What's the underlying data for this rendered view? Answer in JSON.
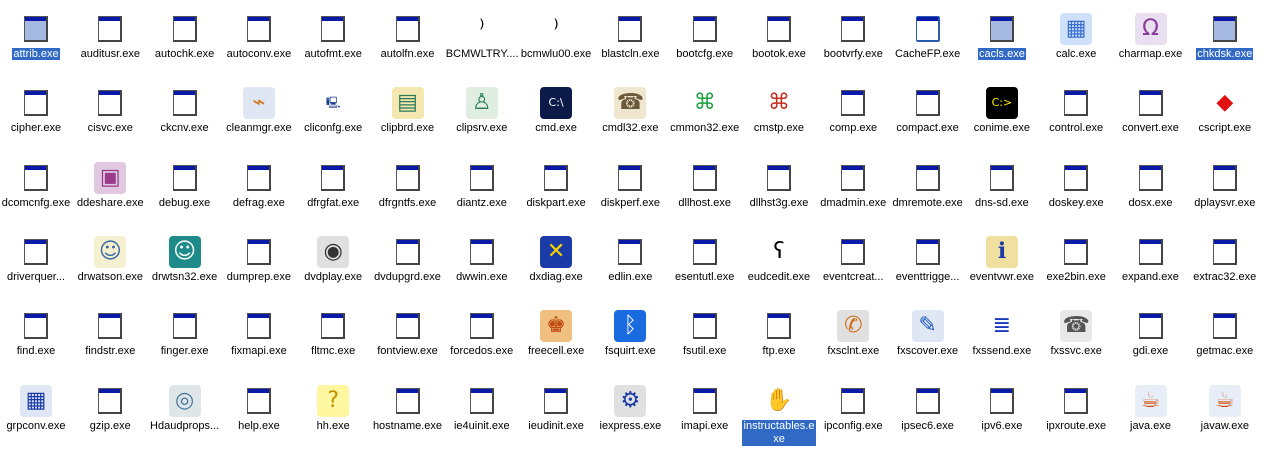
{
  "window_title": "",
  "accent_color": "#316ac5",
  "items": [
    {
      "name": "attrib.exe",
      "icon": "window",
      "selected": true
    },
    {
      "name": "auditusr.exe",
      "icon": "window"
    },
    {
      "name": "autochk.exe",
      "icon": "window"
    },
    {
      "name": "autoconv.exe",
      "icon": "window"
    },
    {
      "name": "autofmt.exe",
      "icon": "window"
    },
    {
      "name": "autolfn.exe",
      "icon": "window"
    },
    {
      "name": "BCMWLTRY....",
      "icon": "antenna"
    },
    {
      "name": "bcmwlu00.exe",
      "icon": "antenna"
    },
    {
      "name": "blastcln.exe",
      "icon": "window"
    },
    {
      "name": "bootcfg.exe",
      "icon": "window"
    },
    {
      "name": "bootok.exe",
      "icon": "window"
    },
    {
      "name": "bootvrfy.exe",
      "icon": "window"
    },
    {
      "name": "CacheFP.exe",
      "icon": "window-plain"
    },
    {
      "name": "cacls.exe",
      "icon": "window",
      "selected": true
    },
    {
      "name": "calc.exe",
      "icon": "calculator"
    },
    {
      "name": "charmap.exe",
      "icon": "charmap"
    },
    {
      "name": "chkdsk.exe",
      "icon": "window",
      "selected": true
    },
    {
      "name": "cipher.exe",
      "icon": "window"
    },
    {
      "name": "cisvc.exe",
      "icon": "window"
    },
    {
      "name": "ckcnv.exe",
      "icon": "window"
    },
    {
      "name": "cleanmgr.exe",
      "icon": "broom"
    },
    {
      "name": "cliconfg.exe",
      "icon": "network-computer"
    },
    {
      "name": "clipbrd.exe",
      "icon": "clipboard-book"
    },
    {
      "name": "clipsrv.exe",
      "icon": "clipboard-hand"
    },
    {
      "name": "cmd.exe",
      "icon": "console"
    },
    {
      "name": "cmdl32.exe",
      "icon": "phone"
    },
    {
      "name": "cmmon32.exe",
      "icon": "knot"
    },
    {
      "name": "cmstp.exe",
      "icon": "knot-small"
    },
    {
      "name": "comp.exe",
      "icon": "window"
    },
    {
      "name": "compact.exe",
      "icon": "window"
    },
    {
      "name": "conime.exe",
      "icon": "ime-console"
    },
    {
      "name": "control.exe",
      "icon": "window"
    },
    {
      "name": "convert.exe",
      "icon": "window"
    },
    {
      "name": "cscript.exe",
      "icon": "script-cube"
    },
    {
      "name": "dcomcnfg.exe",
      "icon": "window"
    },
    {
      "name": "ddeshare.exe",
      "icon": "safe"
    },
    {
      "name": "debug.exe",
      "icon": "window"
    },
    {
      "name": "defrag.exe",
      "icon": "window"
    },
    {
      "name": "dfrgfat.exe",
      "icon": "window"
    },
    {
      "name": "dfrgntfs.exe",
      "icon": "window"
    },
    {
      "name": "diantz.exe",
      "icon": "window"
    },
    {
      "name": "diskpart.exe",
      "icon": "window"
    },
    {
      "name": "diskperf.exe",
      "icon": "window"
    },
    {
      "name": "dllhost.exe",
      "icon": "window"
    },
    {
      "name": "dllhst3g.exe",
      "icon": "window"
    },
    {
      "name": "dmadmin.exe",
      "icon": "window"
    },
    {
      "name": "dmremote.exe",
      "icon": "window"
    },
    {
      "name": "dns-sd.exe",
      "icon": "window"
    },
    {
      "name": "doskey.exe",
      "icon": "window"
    },
    {
      "name": "dosx.exe",
      "icon": "window"
    },
    {
      "name": "dplaysvr.exe",
      "icon": "window"
    },
    {
      "name": "driverquer...",
      "icon": "window"
    },
    {
      "name": "drwatson.exe",
      "icon": "doctor"
    },
    {
      "name": "drwtsn32.exe",
      "icon": "doctor-teal"
    },
    {
      "name": "dumprep.exe",
      "icon": "window"
    },
    {
      "name": "dvdplay.exe",
      "icon": "dvd"
    },
    {
      "name": "dvdupgrd.exe",
      "icon": "window"
    },
    {
      "name": "dwwin.exe",
      "icon": "window"
    },
    {
      "name": "dxdiag.exe",
      "icon": "directx"
    },
    {
      "name": "edlin.exe",
      "icon": "window"
    },
    {
      "name": "esentutl.exe",
      "icon": "window"
    },
    {
      "name": "eudcedit.exe",
      "icon": "char-editor"
    },
    {
      "name": "eventcreat...",
      "icon": "window"
    },
    {
      "name": "eventtrigge...",
      "icon": "window"
    },
    {
      "name": "eventvwr.exe",
      "icon": "event-log"
    },
    {
      "name": "exe2bin.exe",
      "icon": "window"
    },
    {
      "name": "expand.exe",
      "icon": "window"
    },
    {
      "name": "extrac32.exe",
      "icon": "window"
    },
    {
      "name": "find.exe",
      "icon": "window"
    },
    {
      "name": "findstr.exe",
      "icon": "window"
    },
    {
      "name": "finger.exe",
      "icon": "window"
    },
    {
      "name": "fixmapi.exe",
      "icon": "window"
    },
    {
      "name": "fltmc.exe",
      "icon": "window"
    },
    {
      "name": "fontview.exe",
      "icon": "window"
    },
    {
      "name": "forcedos.exe",
      "icon": "window"
    },
    {
      "name": "freecell.exe",
      "icon": "freecell-king"
    },
    {
      "name": "fsquirt.exe",
      "icon": "bluetooth"
    },
    {
      "name": "fsutil.exe",
      "icon": "window"
    },
    {
      "name": "ftp.exe",
      "icon": "window"
    },
    {
      "name": "fxsclnt.exe",
      "icon": "fax-client"
    },
    {
      "name": "fxscover.exe",
      "icon": "fax-cover"
    },
    {
      "name": "fxssend.exe",
      "icon": "fax-document"
    },
    {
      "name": "fxssvc.exe",
      "icon": "fax-machine"
    },
    {
      "name": "gdi.exe",
      "icon": "window"
    },
    {
      "name": "getmac.exe",
      "icon": "window"
    },
    {
      "name": "grpconv.exe",
      "icon": "program-group"
    },
    {
      "name": "gzip.exe",
      "icon": "window"
    },
    {
      "name": "Hdaudprops...",
      "icon": "speaker"
    },
    {
      "name": "help.exe",
      "icon": "window"
    },
    {
      "name": "hh.exe",
      "icon": "help-question"
    },
    {
      "name": "hostname.exe",
      "icon": "window"
    },
    {
      "name": "ie4uinit.exe",
      "icon": "window"
    },
    {
      "name": "ieudinit.exe",
      "icon": "window"
    },
    {
      "name": "iexpress.exe",
      "icon": "installer"
    },
    {
      "name": "imapi.exe",
      "icon": "window"
    },
    {
      "name": "instructables.exe",
      "icon": "hand",
      "selected": true,
      "wrap": true
    },
    {
      "name": "ipconfig.exe",
      "icon": "window"
    },
    {
      "name": "ipsec6.exe",
      "icon": "window"
    },
    {
      "name": "ipv6.exe",
      "icon": "window"
    },
    {
      "name": "ipxroute.exe",
      "icon": "window"
    },
    {
      "name": "java.exe",
      "icon": "java"
    },
    {
      "name": "javaw.exe",
      "icon": "java"
    }
  ]
}
